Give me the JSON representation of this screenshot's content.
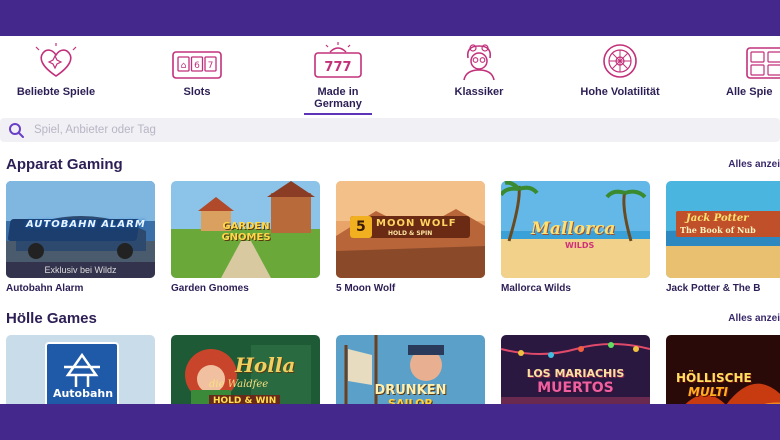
{
  "colors": {
    "brand": "#44288b",
    "text": "#2d1f55",
    "accent": "#c2307a",
    "search_bg": "#f1f0f4"
  },
  "categories": [
    {
      "label": "Beliebte Spiele",
      "icon": "heart-sparkle-icon"
    },
    {
      "label": "Slots",
      "icon": "slot-machine-icon"
    },
    {
      "label": "Made in Germany",
      "icon": "777-slot-icon",
      "active": true
    },
    {
      "label": "Klassiker",
      "icon": "classic-character-icon"
    },
    {
      "label": "Hohe Volatilität",
      "icon": "roulette-wheel-icon"
    },
    {
      "label": "Alle Spie",
      "icon": "all-games-grid-icon"
    }
  ],
  "search": {
    "placeholder": "Spiel, Anbieter oder Tag"
  },
  "sections": [
    {
      "title": "Apparat Gaming",
      "link": "Alles anzei",
      "games": [
        {
          "name": "Autobahn Alarm",
          "logo": "AUTOBAHN ALARM",
          "badge": "Exklusiv bei Wildz"
        },
        {
          "name": "Garden Gnomes",
          "logo": "GARDEN GNOMES"
        },
        {
          "name": "5 Moon Wolf",
          "logo_num": "5",
          "logo": "MOON WOLF",
          "logo_sub": "HOLD & SPIN"
        },
        {
          "name": "Mallorca Wilds",
          "logo": "Mallorca",
          "logo_sub": "WILDS"
        },
        {
          "name": "Jack Potter & The B",
          "logo": "Jack Potter",
          "logo_sub": "The Book of Nub"
        }
      ]
    },
    {
      "title": "Hölle Games",
      "link": "Alles anzei",
      "games": [
        {
          "logo": "Autobahn"
        },
        {
          "logo": "Holla",
          "logo_mid": "die Waldfee",
          "logo_sub": "HOLD & WIN"
        },
        {
          "logo": "DRUNKEN",
          "logo_sub": "SAILOR"
        },
        {
          "logo": "LOS MARIACHIS",
          "logo_sub": "MUERTOS"
        },
        {
          "logo": "HÖLLISCHE",
          "logo_sub": "MULTI"
        }
      ]
    }
  ]
}
